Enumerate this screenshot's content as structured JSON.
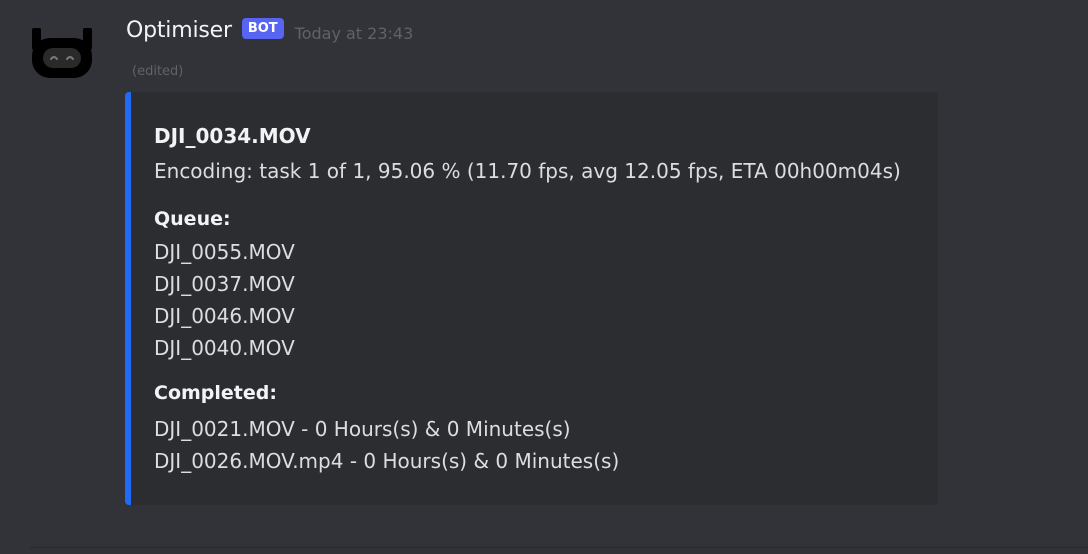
{
  "author": {
    "username": "Optimiser",
    "tag": "BOT",
    "timestamp": "Today at 23:43",
    "edited_label": "(edited)",
    "avatar_icon": "robot-avatar-icon"
  },
  "embed": {
    "accent_color": "#1f6bf5",
    "title": "DJI_0034.MOV",
    "status": "Encoding: task 1 of 1, 95.06 % (11.70 fps, avg 12.05 fps, ETA 00h00m04s)",
    "queue": {
      "name": "Queue:",
      "items": [
        "DJI_0055.MOV",
        "DJI_0037.MOV",
        "DJI_0046.MOV",
        "DJI_0040.MOV"
      ]
    },
    "completed": {
      "name": "Completed:",
      "items": [
        "DJI_0021.MOV - 0 Hours(s) & 0 Minutes(s)",
        "DJI_0026.MOV.mp4 - 0 Hours(s) & 0 Minutes(s)"
      ]
    }
  },
  "colors": {
    "background": "#313338",
    "embed_background": "#2b2d31",
    "bot_tag": "#5865f2"
  }
}
